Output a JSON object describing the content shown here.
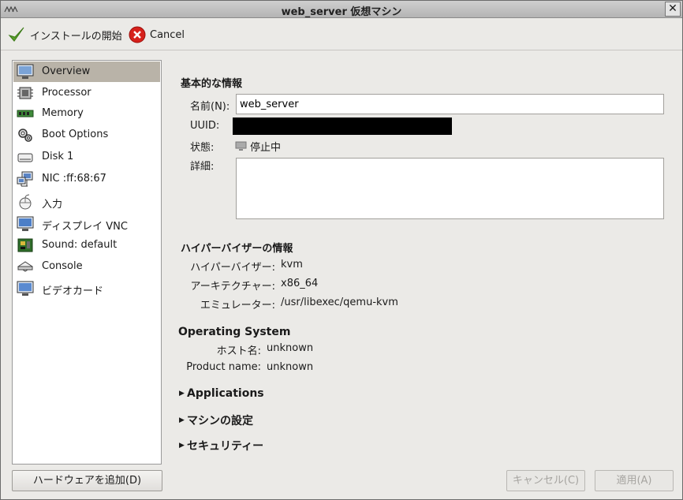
{
  "window": {
    "title": "web_server 仮想マシン"
  },
  "toolbar": {
    "install_label": "インストールの開始",
    "cancel_label": "Cancel"
  },
  "sidebar": {
    "items": [
      {
        "label": "Overview",
        "icon": "monitor-icon"
      },
      {
        "label": "Processor",
        "icon": "cpu-icon"
      },
      {
        "label": "Memory",
        "icon": "memory-icon"
      },
      {
        "label": "Boot Options",
        "icon": "gears-icon"
      },
      {
        "label": "Disk 1",
        "icon": "disk-icon"
      },
      {
        "label": "NIC :ff:68:67",
        "icon": "network-icon"
      },
      {
        "label": "入力",
        "icon": "mouse-icon"
      },
      {
        "label": "ディスプレイ VNC",
        "icon": "display-icon"
      },
      {
        "label": "Sound: default",
        "icon": "sound-card-icon"
      },
      {
        "label": "Console",
        "icon": "serial-icon"
      },
      {
        "label": "ビデオカード",
        "icon": "video-card-icon"
      }
    ],
    "selected": "Overview"
  },
  "footer": {
    "add_hardware": "ハードウェアを追加(D)",
    "cancel": "キャンセル(C)",
    "apply": "適用(A)"
  },
  "basic": {
    "heading": "基本的な情報",
    "name_label": "名前(N):",
    "name_value": "web_server",
    "uuid_label": "UUID:",
    "status_label": "状態:",
    "status_value": "停止中",
    "details_label": "詳細:"
  },
  "hypervisor": {
    "heading": "ハイパーバイザーの情報",
    "hv_label": "ハイパーバイザー:",
    "hv_value": "kvm",
    "arch_label": "アーキテクチャー:",
    "arch_value": "x86_64",
    "emu_label": "エミュレーター:",
    "emu_value": "/usr/libexec/qemu-kvm"
  },
  "os": {
    "heading": "Operating System",
    "host_label": "ホスト名:",
    "host_value": "unknown",
    "product_label": "Product name:",
    "product_value": "unknown"
  },
  "expanders": {
    "applications": "Applications",
    "machine_settings": "マシンの設定",
    "security": "セキュリティー"
  }
}
